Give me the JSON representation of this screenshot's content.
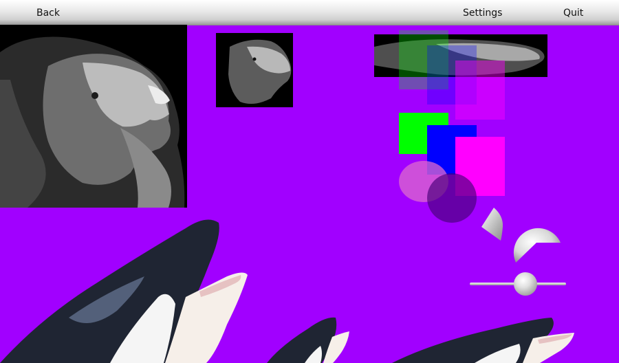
{
  "toolbar": {
    "back_label": "Back",
    "settings_label": "Settings",
    "quit_label": "Quit"
  },
  "images": {
    "lion_large": "lion-photo",
    "lion_small": "lion-photo",
    "lion_stretched": "lion-photo",
    "orca_large": "orca-photo",
    "orca_small": "orca-photo",
    "orca_right": "orca-photo"
  },
  "colors": {
    "background": "#a100ff",
    "green": "#00ff00",
    "blue": "#0000ff",
    "magenta": "#ff00ff",
    "pink_ellipse": "#d45cc8",
    "dark_circle": "#5a0b8f"
  },
  "slider": {
    "value": 0.6
  }
}
